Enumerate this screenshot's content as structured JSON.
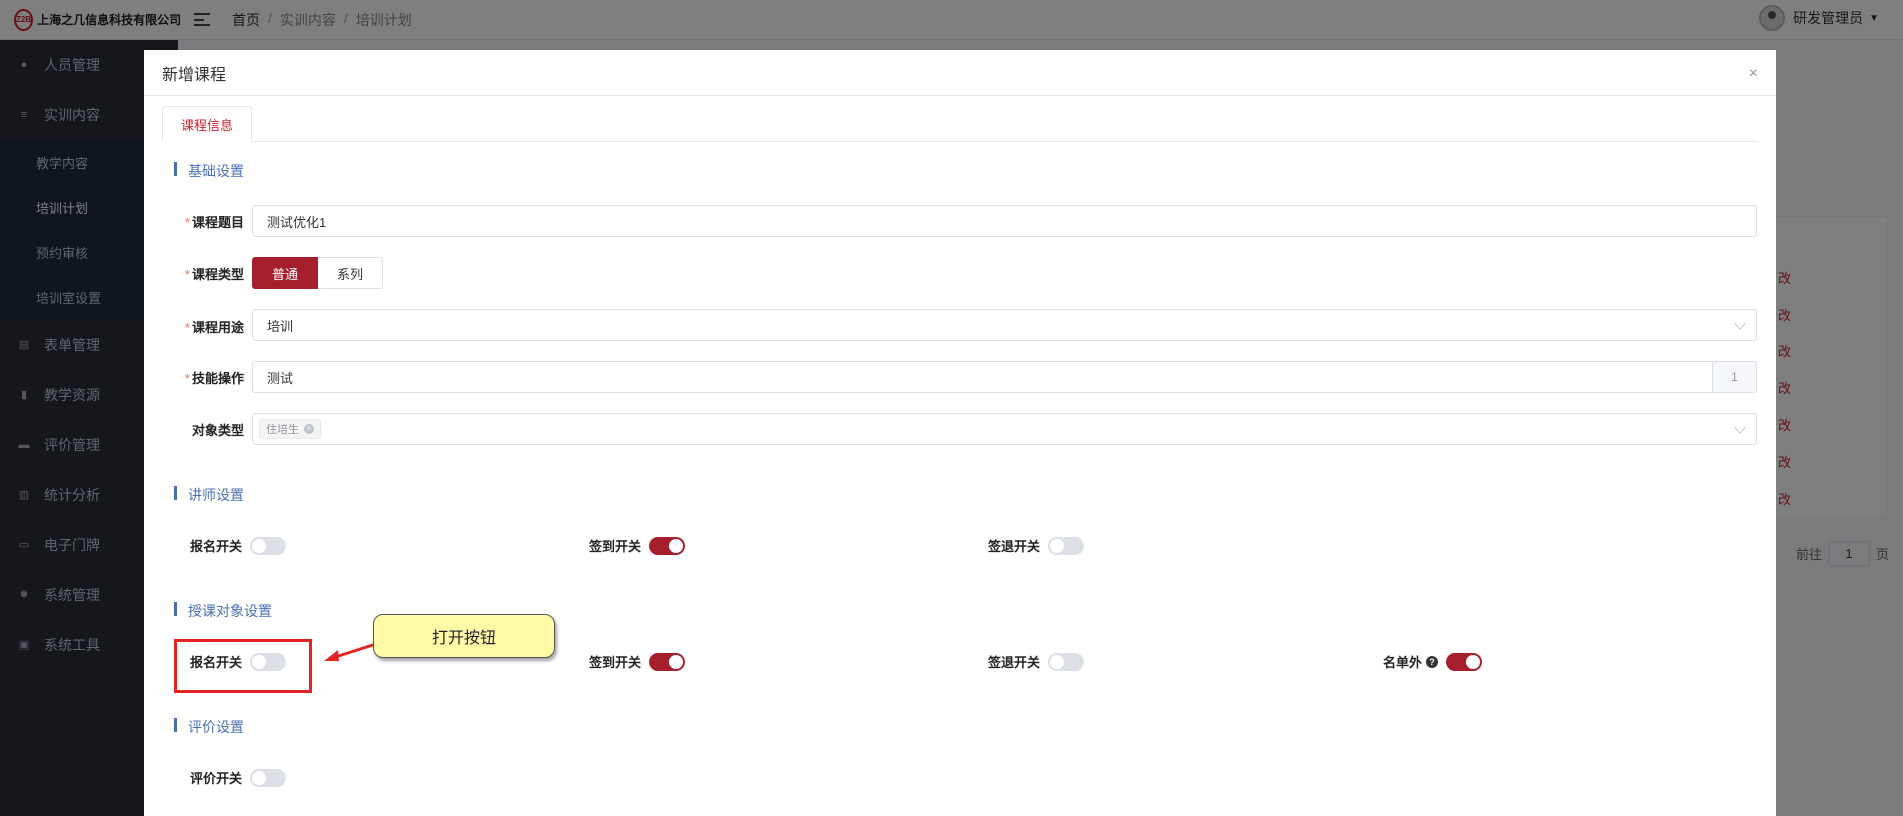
{
  "app": {
    "logo_mark": "Z2B",
    "company": "上海之几信息科技有限公司",
    "breadcrumb": [
      "首页",
      "实训内容",
      "培训计划"
    ],
    "user_name": "研发管理员"
  },
  "sidebar": {
    "items": [
      {
        "label": "人员管理",
        "icon": "user-icon"
      },
      {
        "label": "实训内容",
        "icon": "tree-icon"
      }
    ],
    "sub_items": [
      "教学内容",
      "培训计划",
      "预约审核",
      "培训室设置"
    ],
    "items_after": [
      {
        "label": "表单管理",
        "icon": "form-icon"
      },
      {
        "label": "教学资源",
        "icon": "book-icon"
      },
      {
        "label": "评价管理",
        "icon": "archive-icon"
      },
      {
        "label": "统计分析",
        "icon": "bar-chart-icon"
      },
      {
        "label": "电子门牌",
        "icon": "monitor-icon"
      },
      {
        "label": "系统管理",
        "icon": "gear-icon"
      },
      {
        "label": "系统工具",
        "icon": "toolbox-icon"
      }
    ]
  },
  "background_table": {
    "edit_label": "改",
    "pager_prefix": "前往",
    "pager_value": "1",
    "pager_suffix": "页"
  },
  "modal": {
    "title": "新增课程",
    "close_symbol": "×",
    "tab": "课程信息",
    "sections": {
      "basic": "基础设置",
      "lecturer": "讲师设置",
      "audience": "授课对象设置",
      "evaluation": "评价设置"
    },
    "form": {
      "course_title_label": "课程题目",
      "course_title_value": "测试优化1",
      "course_type_label": "课程类型",
      "course_type_options": [
        "普通",
        "系列"
      ],
      "course_type_selected": "普通",
      "course_use_label": "课程用途",
      "course_use_value": "培训",
      "skill_label": "技能操作",
      "skill_value": "测试",
      "skill_count": "1",
      "target_type_label": "对象类型",
      "target_type_tag": "住培生",
      "required_mark": "*"
    },
    "lecturer_switches": [
      {
        "label": "报名开关",
        "on": false
      },
      {
        "label": "签到开关",
        "on": true
      },
      {
        "label": "签退开关",
        "on": false
      }
    ],
    "audience_switches": [
      {
        "label": "报名开关",
        "on": false
      },
      {
        "label": "签到开关",
        "on": true
      },
      {
        "label": "签退开关",
        "on": false
      },
      {
        "label": "名单外",
        "on": true,
        "help": "?"
      }
    ],
    "evaluation_switches": [
      {
        "label": "评价开关",
        "on": false
      }
    ]
  },
  "annotation": {
    "callout_text": "打开按钮",
    "box_color": "#e32424",
    "callout_bg": "#fffaa8"
  },
  "colors": {
    "primary": "#a51f2d",
    "section": "#4a6fb5",
    "sidebar_bg": "#2b2f3a"
  }
}
